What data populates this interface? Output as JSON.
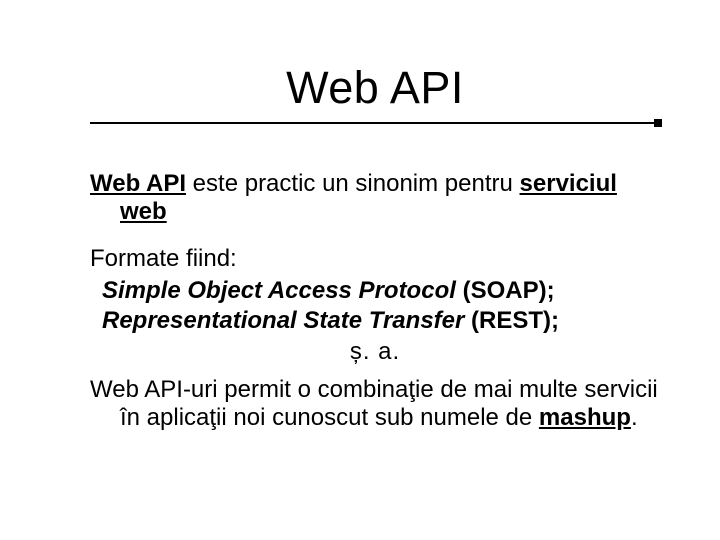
{
  "title": "Web API",
  "intro": {
    "strong1": "Web API",
    "mid": " este practic un sinonim pentru ",
    "strong2": "serviciul web"
  },
  "formats_label": "Formate fiind:",
  "formats": [
    {
      "name": "Simple Object Access Protocol",
      "suffix": " (SOAP);"
    },
    {
      "name": "Representational State Transfer",
      "suffix": " (REST);"
    }
  ],
  "etc": "ș. a.",
  "closing": {
    "pre": "Web API-uri permit o combinaţie de mai multe servicii în aplicaţii noi cunoscut sub numele de ",
    "mashup": "mashup",
    "post": "."
  }
}
